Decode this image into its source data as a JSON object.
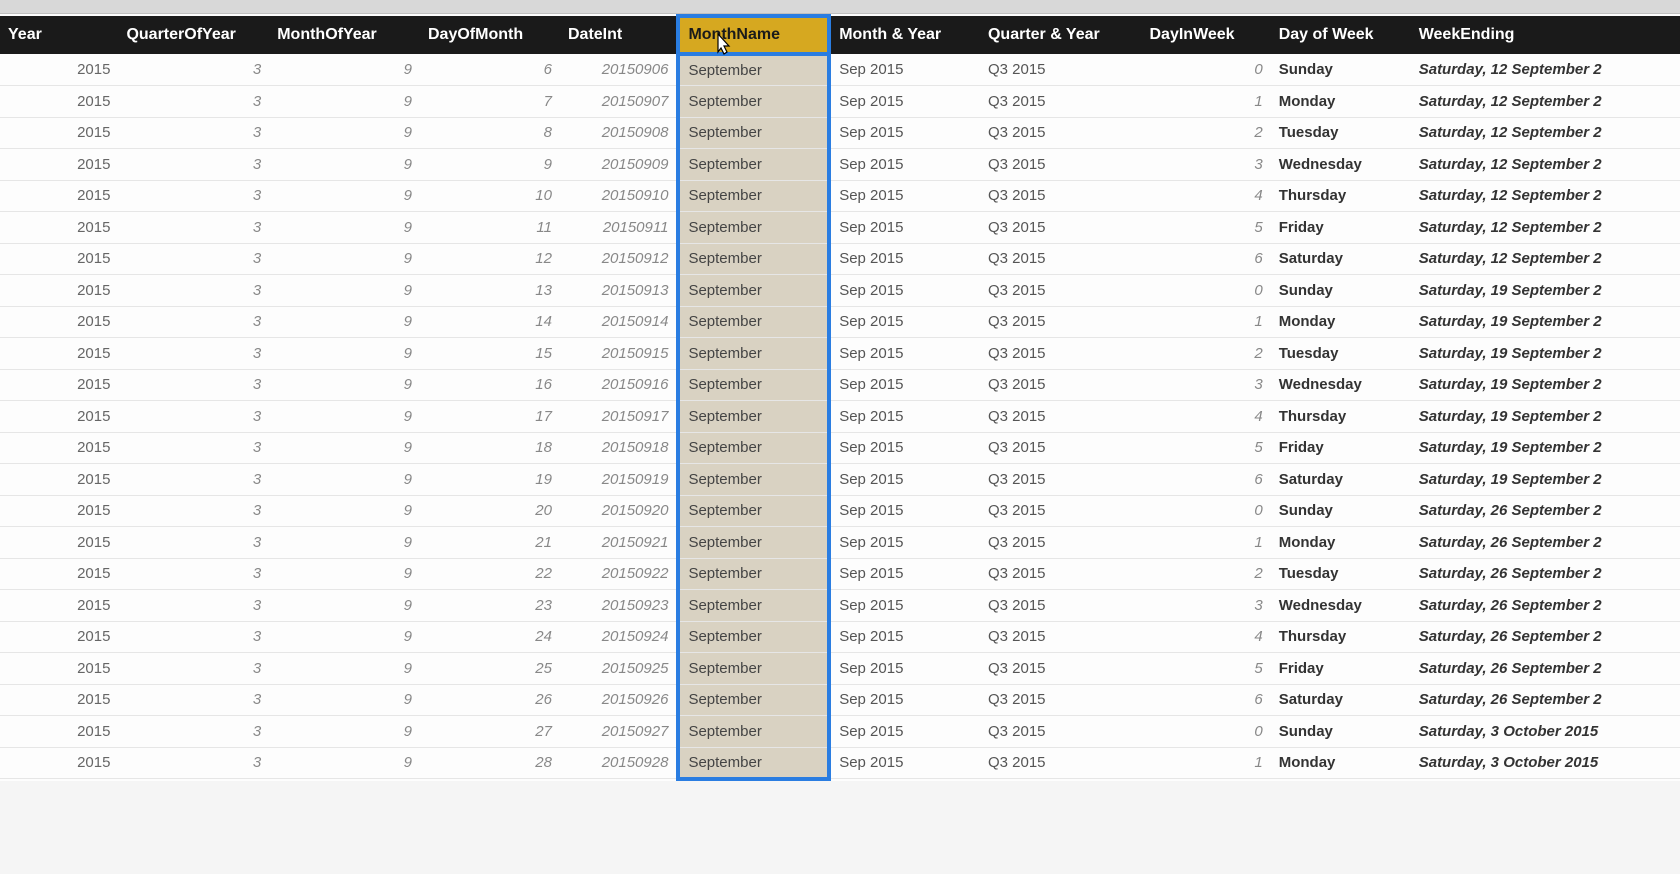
{
  "columns": [
    {
      "key": "year",
      "label": "Year",
      "cls": "col-year",
      "align": "num",
      "italic": false,
      "selected": false
    },
    {
      "key": "quarterOfYear",
      "label": "QuarterOfYear",
      "cls": "col-quarter",
      "align": "num",
      "italic": true,
      "selected": false
    },
    {
      "key": "monthOfYear",
      "label": "MonthOfYear",
      "cls": "col-month",
      "align": "num",
      "italic": true,
      "selected": false
    },
    {
      "key": "dayOfMonth",
      "label": "DayOfMonth",
      "cls": "col-day",
      "align": "num",
      "italic": true,
      "selected": false
    },
    {
      "key": "dateInt",
      "label": "DateInt",
      "cls": "col-dateint",
      "align": "num",
      "italic": true,
      "selected": false
    },
    {
      "key": "monthName",
      "label": "MonthName",
      "cls": "col-monthname",
      "align": "left",
      "italic": false,
      "selected": true
    },
    {
      "key": "monthYear",
      "label": "Month & Year",
      "cls": "col-monthyear",
      "align": "left",
      "italic": false,
      "selected": false
    },
    {
      "key": "quarterYear",
      "label": "Quarter & Year",
      "cls": "col-qtryear",
      "align": "left",
      "italic": false,
      "selected": false
    },
    {
      "key": "dayInWeek",
      "label": "DayInWeek",
      "cls": "col-dayinweek",
      "align": "num",
      "italic": true,
      "selected": false
    },
    {
      "key": "dayOfWeek",
      "label": "Day of Week",
      "cls": "col-dayofweek",
      "align": "left",
      "italic": false,
      "selected": false,
      "bold": true
    },
    {
      "key": "weekEnding",
      "label": "WeekEnding",
      "cls": "col-weekending",
      "align": "left",
      "italic": true,
      "selected": false,
      "bold": true
    }
  ],
  "rows": [
    {
      "year": "2015",
      "quarterOfYear": "3",
      "monthOfYear": "9",
      "dayOfMonth": "6",
      "dateInt": "20150906",
      "monthName": "September",
      "monthYear": "Sep 2015",
      "quarterYear": "Q3 2015",
      "dayInWeek": "0",
      "dayOfWeek": "Sunday",
      "weekEnding": "Saturday, 12 September 2"
    },
    {
      "year": "2015",
      "quarterOfYear": "3",
      "monthOfYear": "9",
      "dayOfMonth": "7",
      "dateInt": "20150907",
      "monthName": "September",
      "monthYear": "Sep 2015",
      "quarterYear": "Q3 2015",
      "dayInWeek": "1",
      "dayOfWeek": "Monday",
      "weekEnding": "Saturday, 12 September 2"
    },
    {
      "year": "2015",
      "quarterOfYear": "3",
      "monthOfYear": "9",
      "dayOfMonth": "8",
      "dateInt": "20150908",
      "monthName": "September",
      "monthYear": "Sep 2015",
      "quarterYear": "Q3 2015",
      "dayInWeek": "2",
      "dayOfWeek": "Tuesday",
      "weekEnding": "Saturday, 12 September 2"
    },
    {
      "year": "2015",
      "quarterOfYear": "3",
      "monthOfYear": "9",
      "dayOfMonth": "9",
      "dateInt": "20150909",
      "monthName": "September",
      "monthYear": "Sep 2015",
      "quarterYear": "Q3 2015",
      "dayInWeek": "3",
      "dayOfWeek": "Wednesday",
      "weekEnding": "Saturday, 12 September 2"
    },
    {
      "year": "2015",
      "quarterOfYear": "3",
      "monthOfYear": "9",
      "dayOfMonth": "10",
      "dateInt": "20150910",
      "monthName": "September",
      "monthYear": "Sep 2015",
      "quarterYear": "Q3 2015",
      "dayInWeek": "4",
      "dayOfWeek": "Thursday",
      "weekEnding": "Saturday, 12 September 2"
    },
    {
      "year": "2015",
      "quarterOfYear": "3",
      "monthOfYear": "9",
      "dayOfMonth": "11",
      "dateInt": "20150911",
      "monthName": "September",
      "monthYear": "Sep 2015",
      "quarterYear": "Q3 2015",
      "dayInWeek": "5",
      "dayOfWeek": "Friday",
      "weekEnding": "Saturday, 12 September 2"
    },
    {
      "year": "2015",
      "quarterOfYear": "3",
      "monthOfYear": "9",
      "dayOfMonth": "12",
      "dateInt": "20150912",
      "monthName": "September",
      "monthYear": "Sep 2015",
      "quarterYear": "Q3 2015",
      "dayInWeek": "6",
      "dayOfWeek": "Saturday",
      "weekEnding": "Saturday, 12 September 2"
    },
    {
      "year": "2015",
      "quarterOfYear": "3",
      "monthOfYear": "9",
      "dayOfMonth": "13",
      "dateInt": "20150913",
      "monthName": "September",
      "monthYear": "Sep 2015",
      "quarterYear": "Q3 2015",
      "dayInWeek": "0",
      "dayOfWeek": "Sunday",
      "weekEnding": "Saturday, 19 September 2"
    },
    {
      "year": "2015",
      "quarterOfYear": "3",
      "monthOfYear": "9",
      "dayOfMonth": "14",
      "dateInt": "20150914",
      "monthName": "September",
      "monthYear": "Sep 2015",
      "quarterYear": "Q3 2015",
      "dayInWeek": "1",
      "dayOfWeek": "Monday",
      "weekEnding": "Saturday, 19 September 2"
    },
    {
      "year": "2015",
      "quarterOfYear": "3",
      "monthOfYear": "9",
      "dayOfMonth": "15",
      "dateInt": "20150915",
      "monthName": "September",
      "monthYear": "Sep 2015",
      "quarterYear": "Q3 2015",
      "dayInWeek": "2",
      "dayOfWeek": "Tuesday",
      "weekEnding": "Saturday, 19 September 2"
    },
    {
      "year": "2015",
      "quarterOfYear": "3",
      "monthOfYear": "9",
      "dayOfMonth": "16",
      "dateInt": "20150916",
      "monthName": "September",
      "monthYear": "Sep 2015",
      "quarterYear": "Q3 2015",
      "dayInWeek": "3",
      "dayOfWeek": "Wednesday",
      "weekEnding": "Saturday, 19 September 2"
    },
    {
      "year": "2015",
      "quarterOfYear": "3",
      "monthOfYear": "9",
      "dayOfMonth": "17",
      "dateInt": "20150917",
      "monthName": "September",
      "monthYear": "Sep 2015",
      "quarterYear": "Q3 2015",
      "dayInWeek": "4",
      "dayOfWeek": "Thursday",
      "weekEnding": "Saturday, 19 September 2"
    },
    {
      "year": "2015",
      "quarterOfYear": "3",
      "monthOfYear": "9",
      "dayOfMonth": "18",
      "dateInt": "20150918",
      "monthName": "September",
      "monthYear": "Sep 2015",
      "quarterYear": "Q3 2015",
      "dayInWeek": "5",
      "dayOfWeek": "Friday",
      "weekEnding": "Saturday, 19 September 2"
    },
    {
      "year": "2015",
      "quarterOfYear": "3",
      "monthOfYear": "9",
      "dayOfMonth": "19",
      "dateInt": "20150919",
      "monthName": "September",
      "monthYear": "Sep 2015",
      "quarterYear": "Q3 2015",
      "dayInWeek": "6",
      "dayOfWeek": "Saturday",
      "weekEnding": "Saturday, 19 September 2"
    },
    {
      "year": "2015",
      "quarterOfYear": "3",
      "monthOfYear": "9",
      "dayOfMonth": "20",
      "dateInt": "20150920",
      "monthName": "September",
      "monthYear": "Sep 2015",
      "quarterYear": "Q3 2015",
      "dayInWeek": "0",
      "dayOfWeek": "Sunday",
      "weekEnding": "Saturday, 26 September 2"
    },
    {
      "year": "2015",
      "quarterOfYear": "3",
      "monthOfYear": "9",
      "dayOfMonth": "21",
      "dateInt": "20150921",
      "monthName": "September",
      "monthYear": "Sep 2015",
      "quarterYear": "Q3 2015",
      "dayInWeek": "1",
      "dayOfWeek": "Monday",
      "weekEnding": "Saturday, 26 September 2"
    },
    {
      "year": "2015",
      "quarterOfYear": "3",
      "monthOfYear": "9",
      "dayOfMonth": "22",
      "dateInt": "20150922",
      "monthName": "September",
      "monthYear": "Sep 2015",
      "quarterYear": "Q3 2015",
      "dayInWeek": "2",
      "dayOfWeek": "Tuesday",
      "weekEnding": "Saturday, 26 September 2"
    },
    {
      "year": "2015",
      "quarterOfYear": "3",
      "monthOfYear": "9",
      "dayOfMonth": "23",
      "dateInt": "20150923",
      "monthName": "September",
      "monthYear": "Sep 2015",
      "quarterYear": "Q3 2015",
      "dayInWeek": "3",
      "dayOfWeek": "Wednesday",
      "weekEnding": "Saturday, 26 September 2"
    },
    {
      "year": "2015",
      "quarterOfYear": "3",
      "monthOfYear": "9",
      "dayOfMonth": "24",
      "dateInt": "20150924",
      "monthName": "September",
      "monthYear": "Sep 2015",
      "quarterYear": "Q3 2015",
      "dayInWeek": "4",
      "dayOfWeek": "Thursday",
      "weekEnding": "Saturday, 26 September 2"
    },
    {
      "year": "2015",
      "quarterOfYear": "3",
      "monthOfYear": "9",
      "dayOfMonth": "25",
      "dateInt": "20150925",
      "monthName": "September",
      "monthYear": "Sep 2015",
      "quarterYear": "Q3 2015",
      "dayInWeek": "5",
      "dayOfWeek": "Friday",
      "weekEnding": "Saturday, 26 September 2"
    },
    {
      "year": "2015",
      "quarterOfYear": "3",
      "monthOfYear": "9",
      "dayOfMonth": "26",
      "dateInt": "20150926",
      "monthName": "September",
      "monthYear": "Sep 2015",
      "quarterYear": "Q3 2015",
      "dayInWeek": "6",
      "dayOfWeek": "Saturday",
      "weekEnding": "Saturday, 26 September 2"
    },
    {
      "year": "2015",
      "quarterOfYear": "3",
      "monthOfYear": "9",
      "dayOfMonth": "27",
      "dateInt": "20150927",
      "monthName": "September",
      "monthYear": "Sep 2015",
      "quarterYear": "Q3 2015",
      "dayInWeek": "0",
      "dayOfWeek": "Sunday",
      "weekEnding": "Saturday, 3 October 2015"
    },
    {
      "year": "2015",
      "quarterOfYear": "3",
      "monthOfYear": "9",
      "dayOfMonth": "28",
      "dateInt": "20150928",
      "monthName": "September",
      "monthYear": "Sep 2015",
      "quarterYear": "Q3 2015",
      "dayInWeek": "1",
      "dayOfWeek": "Monday",
      "weekEnding": "Saturday, 3 October 2015"
    }
  ]
}
